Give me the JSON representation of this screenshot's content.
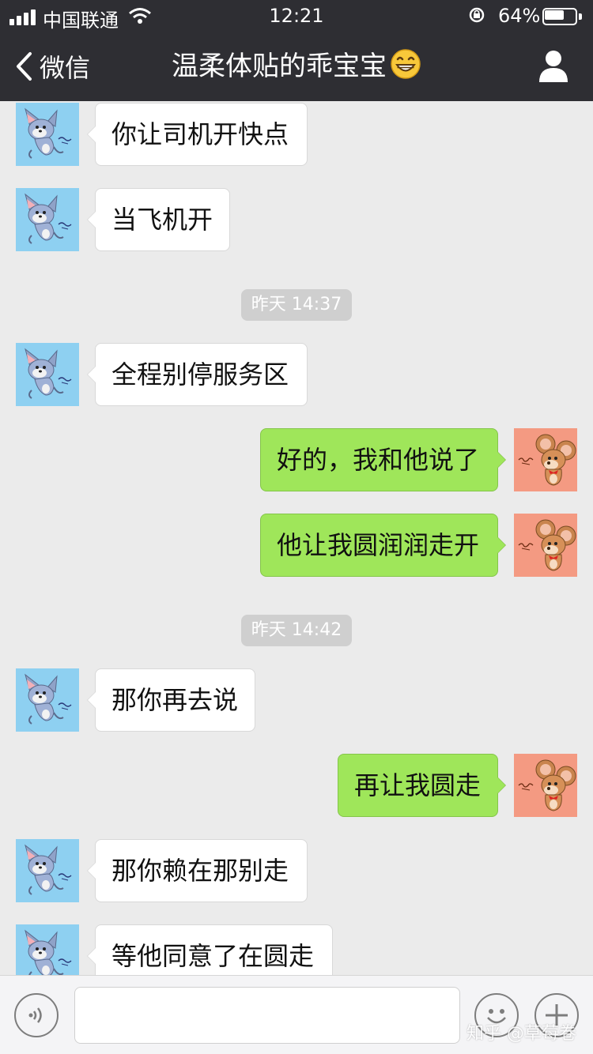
{
  "status_bar": {
    "carrier": "中国联通",
    "time": "12:21",
    "battery_percent": "64%",
    "battery_level": 0.64,
    "icons": [
      "signal-icon",
      "wifi-icon",
      "rotation-lock-icon",
      "battery-icon"
    ]
  },
  "nav": {
    "back_label": "微信",
    "title": "温柔体贴的乖宝宝",
    "title_emoji": "grinning-face-emoji",
    "profile_icon": "person-icon"
  },
  "avatars": {
    "contact": "tom-cat-avatar",
    "me": "jerry-mouse-avatar"
  },
  "messages": [
    {
      "side": "left",
      "text": "你让司机开快点"
    },
    {
      "side": "left",
      "text": "当飞机开"
    },
    {
      "type": "time",
      "text": "昨天 14:37"
    },
    {
      "side": "left",
      "text": "全程别停服务区"
    },
    {
      "side": "right",
      "text": "好的，我和他说了"
    },
    {
      "side": "right",
      "text": "他让我圆润润走开"
    },
    {
      "type": "time",
      "text": "昨天 14:42"
    },
    {
      "side": "left",
      "text": "那你再去说"
    },
    {
      "side": "right",
      "text": "再让我圆走"
    },
    {
      "side": "left",
      "text": "那你赖在那别走"
    },
    {
      "side": "left",
      "text": "等他同意了在圆走"
    }
  ],
  "input_bar": {
    "input_value": "",
    "icons": [
      "voice-icon",
      "emoji-icon",
      "plus-icon"
    ]
  },
  "watermark": "知乎 @草莓卷",
  "colors": {
    "nav_bg": "#2e2e33",
    "chat_bg": "#ebebeb",
    "my_bubble": "#9fe65a",
    "their_bubble": "#ffffff"
  }
}
